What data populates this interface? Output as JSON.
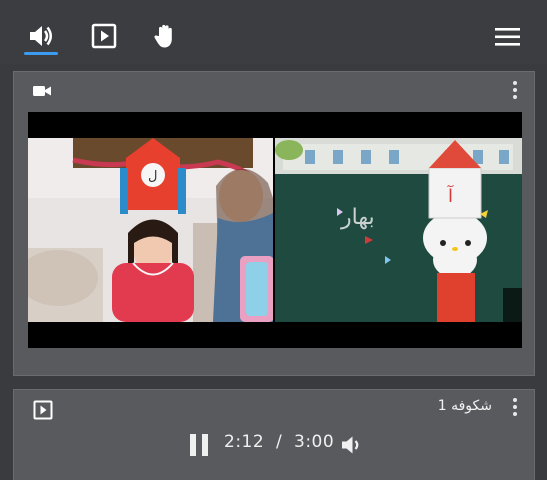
{
  "toolbar": {
    "items": [
      {
        "name": "audio",
        "icon": "speaker-icon",
        "active": true
      },
      {
        "name": "play-media",
        "icon": "play-box-icon",
        "active": false
      },
      {
        "name": "raise-hand",
        "icon": "hand-icon",
        "active": false
      }
    ],
    "menu_icon": "hamburger-menu-icon",
    "accent_color": "#3b9bf0"
  },
  "video_panel": {
    "header_icon": "video-camera-icon",
    "more_icon": "more-vertical-icon"
  },
  "media_panel": {
    "type_icon": "play-box-icon",
    "title": "شکوفه 1",
    "more_icon": "more-vertical-icon",
    "player": {
      "pause_icon": "pause-icon",
      "time_display": "2:12  /  3:00",
      "current_time": "2:12",
      "duration": "3:00",
      "volume_icon": "volume-icon"
    }
  },
  "colors": {
    "background": "#3a3b3e",
    "panel": "#595a5e",
    "icon": "#ffffff"
  }
}
